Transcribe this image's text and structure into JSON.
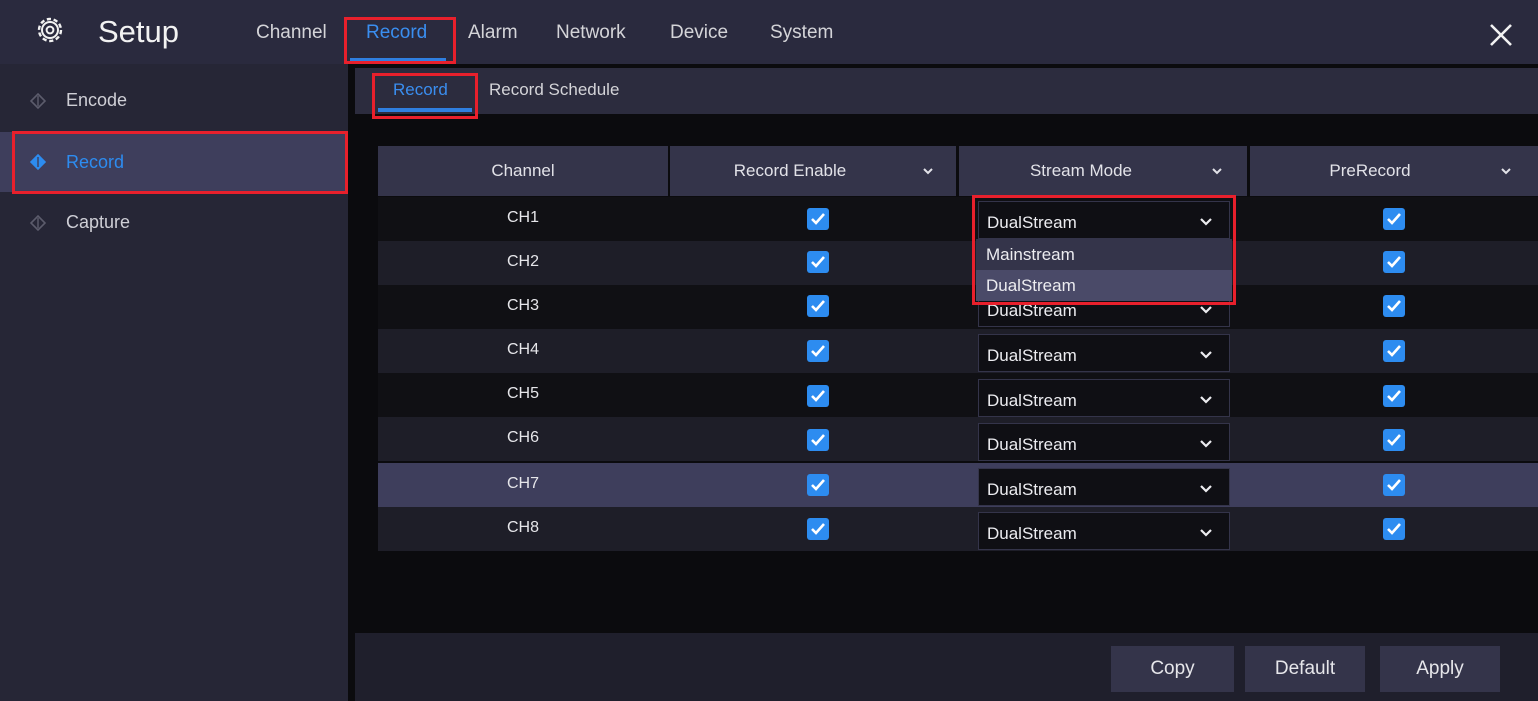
{
  "app": {
    "title": "Setup"
  },
  "top_tabs": [
    "Channel",
    "Record",
    "Alarm",
    "Network",
    "Device",
    "System"
  ],
  "active_top_tab": "Record",
  "sidebar": {
    "items": [
      {
        "label": "Encode"
      },
      {
        "label": "Record"
      },
      {
        "label": "Capture"
      }
    ],
    "active": "Record"
  },
  "sub_tabs": [
    "Record",
    "Record Schedule"
  ],
  "active_sub_tab": "Record",
  "table": {
    "columns": [
      "Channel",
      "Record Enable",
      "Stream Mode",
      "PreRecord"
    ],
    "rows": [
      {
        "channel": "CH1",
        "record_enable": true,
        "stream_mode": "DualStream",
        "prerecord": true
      },
      {
        "channel": "CH2",
        "record_enable": true,
        "stream_mode": "DualStream",
        "prerecord": true
      },
      {
        "channel": "CH3",
        "record_enable": true,
        "stream_mode": "DualStream",
        "prerecord": true
      },
      {
        "channel": "CH4",
        "record_enable": true,
        "stream_mode": "DualStream",
        "prerecord": true
      },
      {
        "channel": "CH5",
        "record_enable": true,
        "stream_mode": "DualStream",
        "prerecord": true
      },
      {
        "channel": "CH6",
        "record_enable": true,
        "stream_mode": "DualStream",
        "prerecord": true
      },
      {
        "channel": "CH7",
        "record_enable": true,
        "stream_mode": "DualStream",
        "prerecord": true
      },
      {
        "channel": "CH8",
        "record_enable": true,
        "stream_mode": "DualStream",
        "prerecord": true
      }
    ],
    "highlighted_row": "CH7"
  },
  "stream_dropdown": {
    "options": [
      "Mainstream",
      "DualStream"
    ],
    "highlighted": "DualStream"
  },
  "buttons": {
    "copy": "Copy",
    "default": "Default",
    "apply": "Apply"
  },
  "colors": {
    "accent": "#2d8cf0",
    "annotation_red": "#e8202c",
    "topbar": "#2a2a3e",
    "sidebar": "#262636",
    "row_highlight": "#3e3e5c"
  },
  "icons": {
    "app": "gear-icon",
    "close": "close-icon",
    "sidebar_bullet": "diamond-icon",
    "dropdown": "chevron-down-icon",
    "checkbox": "checkmark-icon"
  }
}
